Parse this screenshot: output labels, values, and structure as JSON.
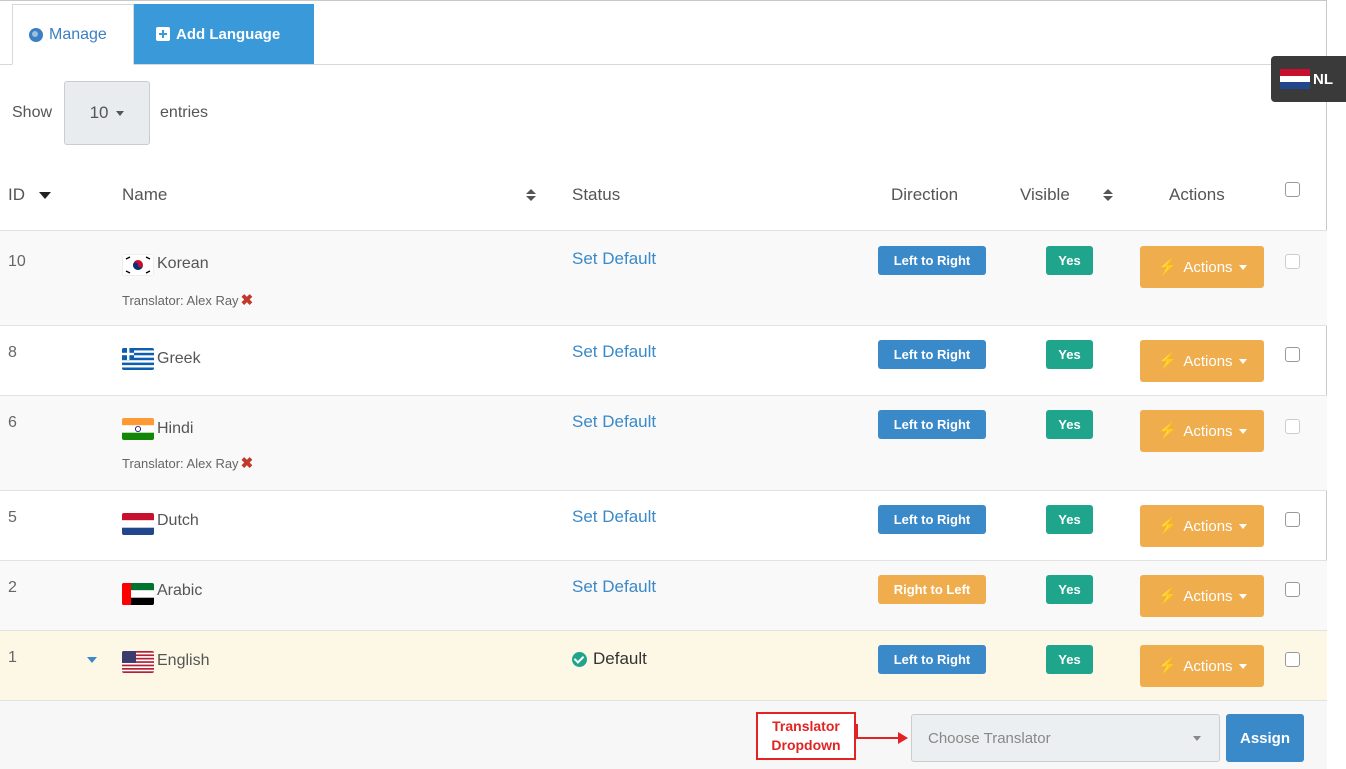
{
  "tabs": {
    "manage": "Manage",
    "add_language": "Add Language"
  },
  "language_chip": {
    "code": "NL"
  },
  "length_menu": {
    "show": "Show",
    "value": "10",
    "entries": "entries"
  },
  "columns": {
    "id": "ID",
    "name": "Name",
    "status": "Status",
    "direction": "Direction",
    "visible": "Visible",
    "actions": "Actions"
  },
  "rows": [
    {
      "id": "10",
      "name": "Korean",
      "translator": "Translator: Alex Ray",
      "status": "Set Default",
      "direction": "Left to Right",
      "visible": "Yes",
      "actions": "Actions",
      "flag": "kr-flag"
    },
    {
      "id": "8",
      "name": "Greek",
      "status": "Set Default",
      "direction": "Left to Right",
      "visible": "Yes",
      "actions": "Actions",
      "flag": "gr-flag"
    },
    {
      "id": "6",
      "name": "Hindi",
      "translator": "Translator: Alex Ray",
      "status": "Set Default",
      "direction": "Left to Right",
      "visible": "Yes",
      "actions": "Actions",
      "flag": "in-flag"
    },
    {
      "id": "5",
      "name": "Dutch",
      "status": "Set Default",
      "direction": "Left to Right",
      "visible": "Yes",
      "actions": "Actions",
      "flag": "nl-flag"
    },
    {
      "id": "2",
      "name": "Arabic",
      "status": "Set Default",
      "direction": "Right to Left",
      "visible": "Yes",
      "actions": "Actions",
      "flag": "ae-flag"
    },
    {
      "id": "1",
      "name": "English",
      "status": "Default",
      "direction": "Left to Right",
      "visible": "Yes",
      "actions": "Actions",
      "flag": "us-flag"
    }
  ],
  "annotation": {
    "line1": "Translator",
    "line2": "Dropdown"
  },
  "translator_select": {
    "placeholder": "Choose Translator"
  },
  "assign_button": "Assign",
  "colors": {
    "primary": "#3a89c9",
    "warning": "#f0ad4e",
    "success": "#1fa58c",
    "annotation": "#e02424"
  }
}
